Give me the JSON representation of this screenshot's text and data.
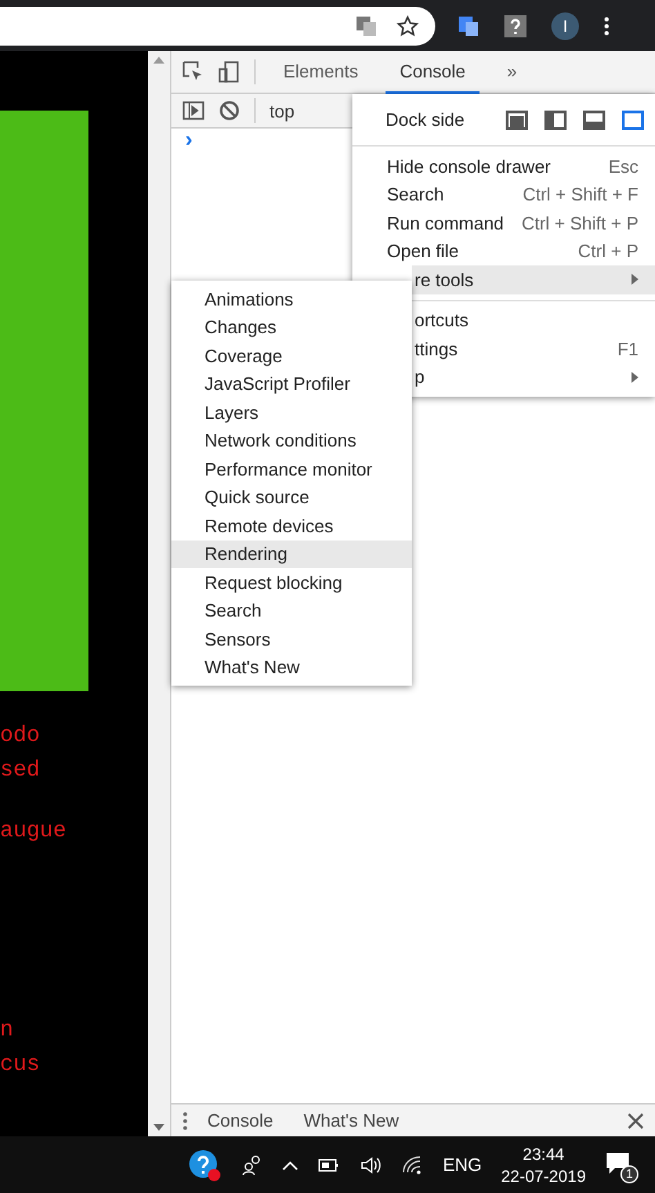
{
  "browser_toolbar": {
    "avatar_letter": "I"
  },
  "page": {
    "text_blocks": [
      [
        "odo",
        "sed"
      ],
      [
        "augue"
      ],
      [
        "n",
        "cus"
      ]
    ]
  },
  "devtools": {
    "tabs": [
      {
        "label": "Elements",
        "selected": false
      },
      {
        "label": "Console",
        "selected": true
      }
    ],
    "overflow": "»",
    "context": "top",
    "prompt": "›",
    "main_menu": {
      "dock_label": "Dock side",
      "dock_options": [
        {
          "kind": "undock",
          "selected": false
        },
        {
          "kind": "left",
          "selected": false
        },
        {
          "kind": "bottom",
          "selected": false
        },
        {
          "kind": "right",
          "selected": true
        }
      ],
      "groups": [
        [
          {
            "label": "Hide console drawer",
            "shortcut": "Esc",
            "selected": false,
            "covered": false
          },
          {
            "label": "Search",
            "shortcut": "Ctrl + Shift + F",
            "selected": false,
            "covered": false
          },
          {
            "label": "Run command",
            "shortcut": "Ctrl + Shift + P",
            "selected": false,
            "covered": false
          },
          {
            "label": "Open file",
            "shortcut": "Ctrl + P",
            "selected": false,
            "covered": false
          },
          {
            "label": "re tools",
            "submenu": true,
            "selected": true,
            "covered": true
          }
        ],
        [
          {
            "label": "ortcuts",
            "selected": false,
            "covered": true
          },
          {
            "label": "ttings",
            "shortcut": "F1",
            "selected": false,
            "covered": true
          },
          {
            "label": "p",
            "submenu": true,
            "selected": false,
            "covered": true
          }
        ]
      ]
    },
    "submenu": [
      {
        "label": "Animations",
        "selected": false
      },
      {
        "label": "Changes",
        "selected": false
      },
      {
        "label": "Coverage",
        "selected": false
      },
      {
        "label": "JavaScript Profiler",
        "selected": false
      },
      {
        "label": "Layers",
        "selected": false
      },
      {
        "label": "Network conditions",
        "selected": false
      },
      {
        "label": "Performance monitor",
        "selected": false
      },
      {
        "label": "Quick source",
        "selected": false
      },
      {
        "label": "Remote devices",
        "selected": false
      },
      {
        "label": "Rendering",
        "selected": true
      },
      {
        "label": "Request blocking",
        "selected": false
      },
      {
        "label": "Search",
        "selected": false
      },
      {
        "label": "Sensors",
        "selected": false
      },
      {
        "label": "What's New",
        "selected": false
      }
    ],
    "drawer_tabs": [
      "Console",
      "What's New"
    ]
  },
  "taskbar": {
    "language": "ENG",
    "time": "23:44",
    "date": "22-07-2019",
    "notification_count": "1"
  }
}
